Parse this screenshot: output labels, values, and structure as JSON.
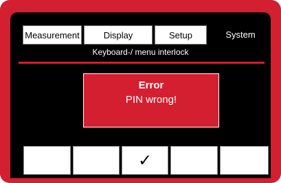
{
  "tabs": [
    {
      "label": "Measurement",
      "active": false
    },
    {
      "label": "Display",
      "active": false
    },
    {
      "label": "Setup",
      "active": false
    },
    {
      "label": "System",
      "active": true
    }
  ],
  "submenu": {
    "title": "Keyboard-/ menu interlock"
  },
  "dialog": {
    "title": "Error",
    "message": "PIN wrong!"
  },
  "softkeys": [
    {
      "label": ""
    },
    {
      "label": ""
    },
    {
      "label": "✓",
      "icon": "checkmark-icon"
    },
    {
      "label": ""
    },
    {
      "label": ""
    }
  ],
  "colors": {
    "frame": "#d41f30",
    "screen": "#000000",
    "dialog": "#d41f30"
  }
}
